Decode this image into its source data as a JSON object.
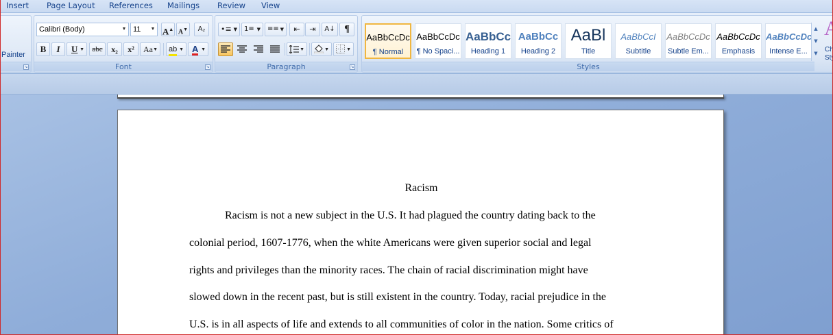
{
  "tabs": [
    "Insert",
    "Page Layout",
    "References",
    "Mailings",
    "Review",
    "View"
  ],
  "clipboard": {
    "painter_label": "Painter"
  },
  "font": {
    "family_value": "Calibri (Body)",
    "size_value": "11",
    "group_label": "Font",
    "bold": "B",
    "italic": "I",
    "underline": "U",
    "strike": "abc",
    "subscript": "x₂",
    "superscript": "x²",
    "change_case": "Aa",
    "grow": "A",
    "shrink": "A",
    "highlight": "ab",
    "font_color": "A",
    "font_color_hex": "#e02020",
    "highlight_hex": "#f3e200"
  },
  "paragraph": {
    "group_label": "Paragraph",
    "pilcrow": "¶"
  },
  "styles": {
    "group_label": "Styles",
    "items": [
      {
        "sample": "AaBbCcDc",
        "name": "¶ Normal"
      },
      {
        "sample": "AaBbCcDc",
        "name": "¶ No Spaci..."
      },
      {
        "sample": "AaBbCc",
        "name": "Heading 1"
      },
      {
        "sample": "AaBbCc",
        "name": "Heading 2"
      },
      {
        "sample": "AaBl",
        "name": "Title"
      },
      {
        "sample": "AaBbCcI",
        "name": "Subtitle"
      },
      {
        "sample": "AaBbCcDc",
        "name": "Subtle Em..."
      },
      {
        "sample": "AaBbCcDc",
        "name": "Emphasis"
      },
      {
        "sample": "AaBbCcDc",
        "name": "Intense E..."
      }
    ],
    "change_styles": {
      "glyph": "A",
      "line1": "Ch",
      "line2": "Sty"
    }
  },
  "document": {
    "title": "Racism",
    "lines": [
      "Racism is not a new subject in the U.S.  It had plagued the country dating back to the",
      "colonial period, 1607-1776, when the white Americans were given superior social and legal",
      "rights and privileges than the minority races. The chain of racial discrimination might have",
      "slowed down in the recent past, but is still existent in the country. Today, racial prejudice in the",
      "U.S. is in all aspects of life and extends to all communities of color in the nation. Some critics of"
    ]
  }
}
